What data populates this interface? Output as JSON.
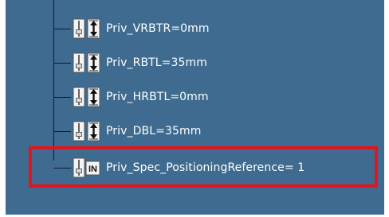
{
  "tree": {
    "items": [
      {
        "label": "Priv_VRBTR=0mm",
        "icon": "parameter-length-icon"
      },
      {
        "label": "Priv_RBTL=35mm",
        "icon": "parameter-length-icon"
      },
      {
        "label": "Priv_HRBTL=0mm",
        "icon": "parameter-length-icon"
      },
      {
        "label": "Priv_DBL=35mm",
        "icon": "parameter-length-icon"
      },
      {
        "label": "Priv_Spec_PositioningReference= 1",
        "icon": "parameter-integer-icon"
      }
    ],
    "selected_index": 4
  },
  "colors": {
    "background": "#3e6b8f",
    "tree_lines": "#121c26",
    "text": "#ffffff",
    "highlight": "#e4141c"
  }
}
